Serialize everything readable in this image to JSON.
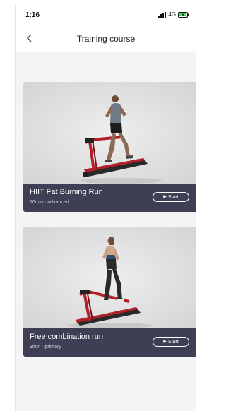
{
  "status_bar": {
    "time": "1:16",
    "network": "4G",
    "icons": [
      "signal-icon",
      "battery-charging-icon"
    ]
  },
  "navbar": {
    "title": "Training course",
    "back_icon": "chevron-left-icon"
  },
  "courses": [
    {
      "title": "HIIT Fat Burning Run",
      "meta": "10min · advanced",
      "button": "Start"
    },
    {
      "title": "Free combination run",
      "meta": "9min · primary",
      "button": "Start"
    }
  ],
  "colors": {
    "card_footer": "#3e3e55",
    "treadmill_red": "#b3202a",
    "page_background": "#f4f4f6"
  }
}
